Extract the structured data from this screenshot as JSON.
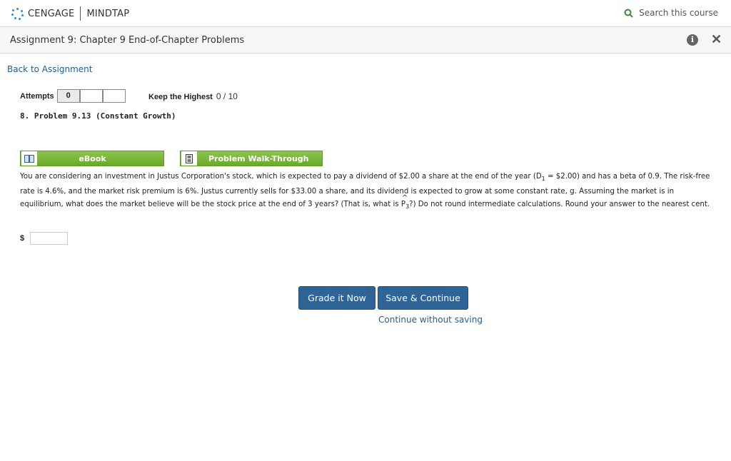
{
  "header": {
    "brand_left": "CENGAGE",
    "brand_right": "MINDTAP",
    "search_label": "Search this course"
  },
  "titlebar": {
    "title": "Assignment 9: Chapter 9 End-of-Chapter Problems"
  },
  "nav": {
    "back_link": "Back to Assignment"
  },
  "attempts": {
    "label": "Attempts",
    "boxes": [
      "0",
      "",
      ""
    ],
    "keep_label": "Keep the Highest",
    "score": "0 / 10"
  },
  "problem": {
    "title": "8.  Problem 9.13 (Constant Growth)",
    "ebook_label": "eBook",
    "walkthrough_label": "Problem Walk-Through",
    "q_part1": "You are considering an investment in Justus Corporation's stock, which is expected to pay a dividend of $2.00 a share at the end of the year (D",
    "q_d1_sub": "1",
    "q_part2": " = $2.00) and has a beta of 0.9. The risk-free rate is 4.6%, and the market risk premium is 6%. Justus currently sells for $33.00 a share, and its dividend is expected to grow at some constant rate, g. Assuming the market is in equilibrium, what does the market believe will be the stock price at the end of 3 years? (That is, what is ",
    "q_p": "P",
    "q_p_sub": "3",
    "q_part3": "?) Do not round intermediate calculations. Round your answer to the nearest cent.",
    "currency": "$",
    "answer_value": ""
  },
  "actions": {
    "grade_label": "Grade it Now",
    "save_label": "Save & Continue",
    "continue_label": "Continue without saving"
  },
  "colors": {
    "accent_blue": "#2e6496",
    "link_blue": "#1f5f94",
    "green": "#7ab83b"
  }
}
